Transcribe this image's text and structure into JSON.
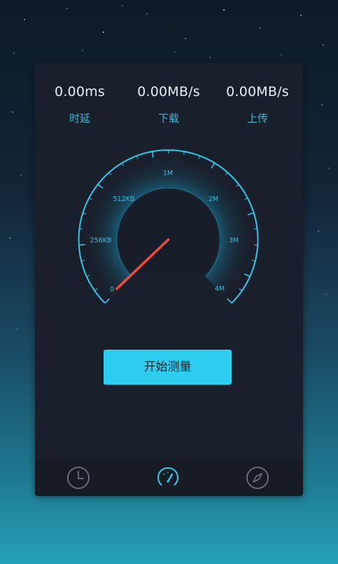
{
  "stats": [
    {
      "value": "0.00ms",
      "label": "时延"
    },
    {
      "value": "0.00MB/s",
      "label": "下载"
    },
    {
      "value": "0.00MB/s",
      "label": "上传"
    }
  ],
  "gauge": {
    "ticks": [
      "0",
      "256KB",
      "512KB",
      "1M",
      "2M",
      "3M",
      "4M"
    ],
    "needle_value": "0"
  },
  "start_button": {
    "label": "开始测量"
  },
  "tabbar": {
    "tabs": [
      {
        "icon": "clock-icon"
      },
      {
        "icon": "speedometer-icon",
        "active": true
      },
      {
        "icon": "compass-icon"
      }
    ]
  },
  "colors": {
    "accent": "#2dcdef",
    "label": "#39b8d9",
    "needle": "#ef4a3c",
    "card": "#1a202b"
  }
}
